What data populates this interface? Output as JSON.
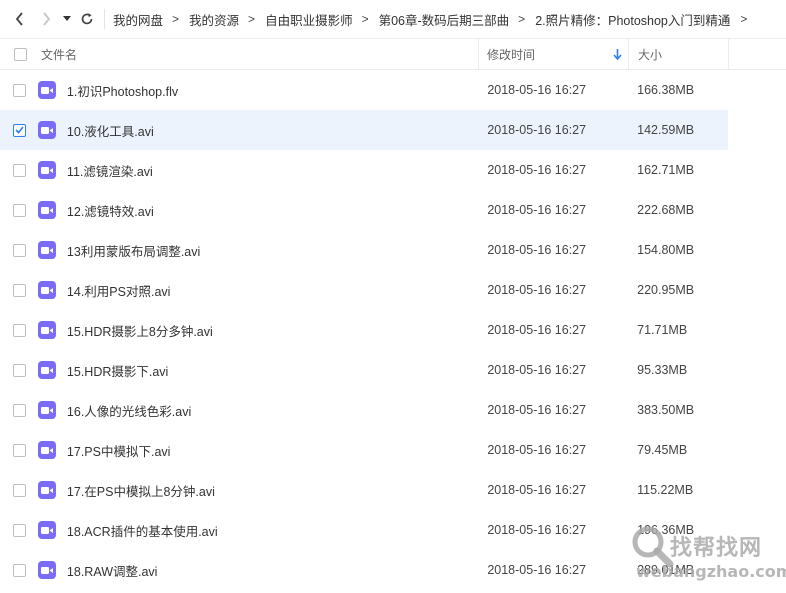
{
  "nav": {
    "back_icon": "chevron-left-icon",
    "forward_icon": "chevron-right-icon",
    "dropdown_icon": "caret-down-icon",
    "refresh_icon": "refresh-icon",
    "more_icon": "chevron-right-icon"
  },
  "breadcrumb": [
    "我的网盘",
    "我的资源",
    "自由职业摄影师",
    "第06章-数码后期三部曲",
    "2.照片精修：Photoshop入门到精通"
  ],
  "breadcrumb_separator": ">",
  "columns": {
    "name": "文件名",
    "modified": "修改时间",
    "size": "大小"
  },
  "files": [
    {
      "name": "1.初识Photoshop.flv",
      "modified": "2018-05-16 16:27",
      "size": "166.38MB",
      "checked": false
    },
    {
      "name": "10.液化工具.avi",
      "modified": "2018-05-16 16:27",
      "size": "142.59MB",
      "checked": true
    },
    {
      "name": "11.滤镜渲染.avi",
      "modified": "2018-05-16 16:27",
      "size": "162.71MB",
      "checked": false
    },
    {
      "name": "12.滤镜特效.avi",
      "modified": "2018-05-16 16:27",
      "size": "222.68MB",
      "checked": false
    },
    {
      "name": "13利用蒙版布局调整.avi",
      "modified": "2018-05-16 16:27",
      "size": "154.80MB",
      "checked": false
    },
    {
      "name": "14.利用PS对照.avi",
      "modified": "2018-05-16 16:27",
      "size": "220.95MB",
      "checked": false
    },
    {
      "name": "15.HDR摄影上8分多钟.avi",
      "modified": "2018-05-16 16:27",
      "size": "71.71MB",
      "checked": false
    },
    {
      "name": "15.HDR摄影下.avi",
      "modified": "2018-05-16 16:27",
      "size": "95.33MB",
      "checked": false
    },
    {
      "name": "16.人像的光线色彩.avi",
      "modified": "2018-05-16 16:27",
      "size": "383.50MB",
      "checked": false
    },
    {
      "name": "17.PS中模拟下.avi",
      "modified": "2018-05-16 16:27",
      "size": "79.45MB",
      "checked": false
    },
    {
      "name": "17.在PS中模拟上8分钟.avi",
      "modified": "2018-05-16 16:27",
      "size": "115.22MB",
      "checked": false
    },
    {
      "name": "18.ACR插件的基本使用.avi",
      "modified": "2018-05-16 16:27",
      "size": "196.36MB",
      "checked": false
    },
    {
      "name": "18.RAW调整.avi",
      "modified": "2018-05-16 16:27",
      "size": "289.01MB",
      "checked": false
    }
  ],
  "file_icon": "video-file-icon",
  "colors": {
    "accent": "#2f7df6",
    "selected_row": "#edf3fd",
    "video_icon": "#7b6cf6"
  },
  "watermark": {
    "text": "找帮找网",
    "url": "webangzhao.com"
  }
}
